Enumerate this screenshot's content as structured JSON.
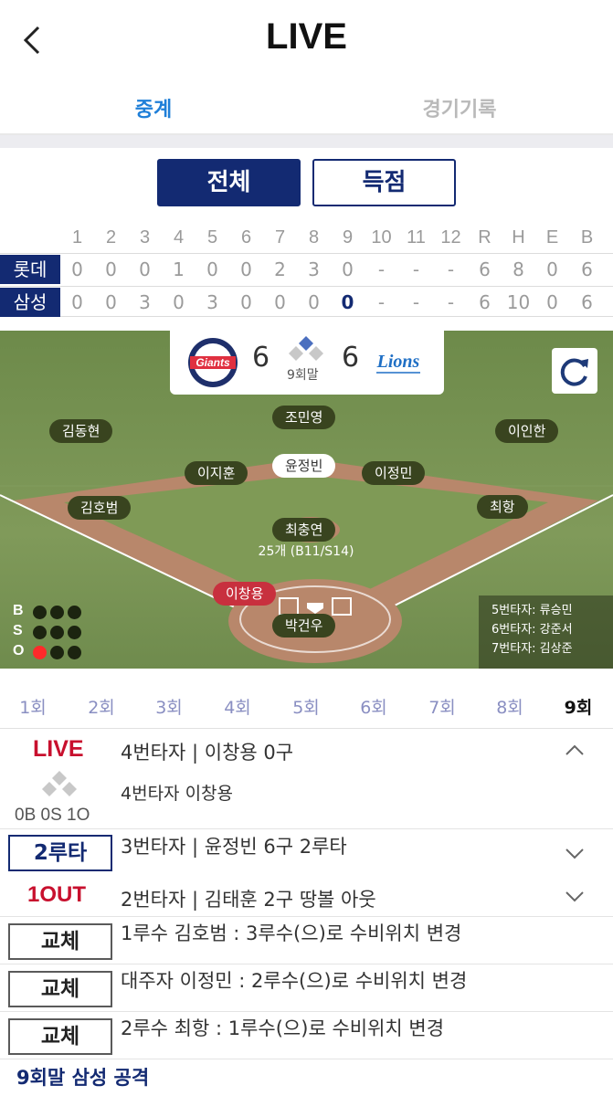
{
  "header": {
    "title": "LIVE",
    "back_icon": "chevron-left-icon"
  },
  "tabs": [
    {
      "label": "중계",
      "active": true
    },
    {
      "label": "경기기록",
      "active": false
    }
  ],
  "filter": {
    "all_label": "전체",
    "score_label": "득점"
  },
  "scoreboard": {
    "columns": [
      "1",
      "2",
      "3",
      "4",
      "5",
      "6",
      "7",
      "8",
      "9",
      "10",
      "11",
      "12",
      "R",
      "H",
      "E",
      "B"
    ],
    "rows": [
      {
        "team": "롯데",
        "cells": [
          "0",
          "0",
          "0",
          "1",
          "0",
          "0",
          "2",
          "3",
          "0",
          "-",
          "-",
          "-",
          "6",
          "8",
          "0",
          "6"
        ]
      },
      {
        "team": "삼성",
        "cells": [
          "0",
          "0",
          "3",
          "0",
          "3",
          "0",
          "0",
          "0",
          "0",
          "-",
          "-",
          "-",
          "6",
          "10",
          "0",
          "6"
        ]
      }
    ]
  },
  "field": {
    "away_score": "6",
    "home_score": "6",
    "inning": "9회말",
    "away_logo_text": "Giants",
    "home_logo_text": "Lions",
    "players": {
      "lf": "김동현",
      "cf": "조민영",
      "rf": "이인한",
      "ss": "이지훈",
      "runner2b": "윤정빈",
      "2b": "이정민",
      "3b": "김호범",
      "1b": "최항",
      "pitcher": "최충연",
      "batter": "이창용",
      "catcher": "박건우"
    },
    "pitch_count": "25개 (B11/S14)",
    "bso": {
      "b_label": "B",
      "s_label": "S",
      "o_label": "O",
      "balls": 0,
      "strikes": 0,
      "outs": 1
    },
    "on_deck": [
      "5번타자: 류승민",
      "6번타자: 강준서",
      "7번타자: 김상준"
    ]
  },
  "innings": [
    "1회",
    "2회",
    "3회",
    "4회",
    "5회",
    "6회",
    "7회",
    "8회",
    "9회"
  ],
  "feed": {
    "live_badge": "LIVE",
    "live_title": "4번타자 | 이창용 0구",
    "live_detail": "4번타자 이창용",
    "live_count": "0B 0S 1O",
    "items": [
      {
        "badge": "2루타",
        "text": "3번타자 | 윤정빈 6구 2루타"
      },
      {
        "badge": "1OUT",
        "text": "2번타자 | 김태훈 2구 땅볼 아웃"
      },
      {
        "badge": "교체",
        "text": "1루수 김호범 : 3루수(으)로 수비위치 변경"
      },
      {
        "badge": "교체",
        "text": "대주자 이정민 : 2루수(으)로 수비위치 변경"
      },
      {
        "badge": "교체",
        "text": "2루수 최항 : 1루수(으)로 수비위치 변경"
      }
    ],
    "section_label": "9회말 삼성 공격"
  },
  "colors": {
    "navy": "#132a72",
    "live_red": "#c8102e",
    "tab_blue": "#1f7fd8"
  }
}
